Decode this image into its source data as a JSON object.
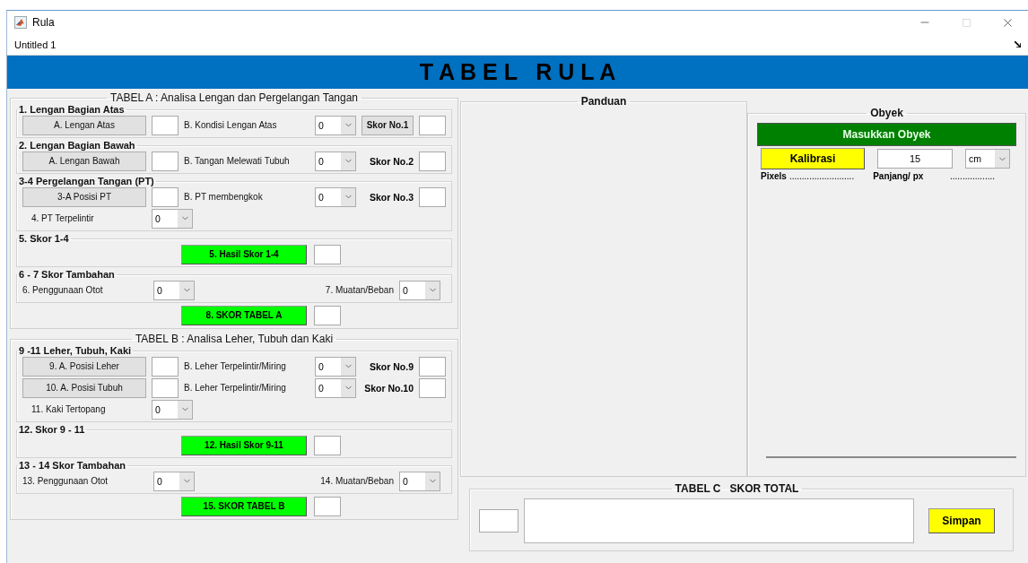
{
  "window": {
    "title": "Rula",
    "menu": "Untitled 1"
  },
  "banner": {
    "title": "T A B E L   R U L A"
  },
  "table_a": {
    "title": "TABEL A : Analisa Lengan dan Pergelangan Tangan",
    "groups": [
      {
        "kind": "grid",
        "title": "1. Lengan Bagian Atas",
        "rows": [
          [
            {
              "kind": "button",
              "label": "A. Lengan Atas"
            },
            {
              "kind": "field"
            },
            {
              "kind": "label",
              "text": "B. Kondisi Lengan Atas"
            },
            {
              "kind": "select",
              "value": "0"
            },
            {
              "kind": "score_button",
              "label": "Skor No.1"
            },
            {
              "kind": "field"
            }
          ]
        ]
      },
      {
        "kind": "grid",
        "title": "2. Lengan Bagian Bawah",
        "rows": [
          [
            {
              "kind": "button",
              "label": "A. Lengan Bawah"
            },
            {
              "kind": "field"
            },
            {
              "kind": "label",
              "text": "B. Tangan Melewati Tubuh"
            },
            {
              "kind": "select",
              "value": "0"
            },
            {
              "kind": "score_label",
              "text": "Skor No.2"
            },
            {
              "kind": "field"
            }
          ]
        ]
      },
      {
        "kind": "grid",
        "title": "3-4 Pergelangan Tangan (PT)",
        "rows": [
          [
            {
              "kind": "button",
              "label": "3-A Posisi PT"
            },
            {
              "kind": "field"
            },
            {
              "kind": "label",
              "text": "B. PT membengkok"
            },
            {
              "kind": "select",
              "value": "0"
            },
            {
              "kind": "score_label",
              "text": "Skor No.3"
            },
            {
              "kind": "field"
            }
          ],
          [
            {
              "kind": "label",
              "text": "4. PT Terpelintir"
            },
            {
              "kind": "select",
              "value": "0"
            }
          ]
        ]
      },
      {
        "kind": "center",
        "title": "5. Skor 1-4",
        "rows": [
          [
            {
              "kind": "green_button",
              "label": "5. Hasil Skor 1-4"
            },
            {
              "kind": "field"
            }
          ]
        ]
      },
      {
        "kind": "pairs",
        "title": "6 - 7 Skor Tambahan",
        "rows": [
          [
            {
              "kind": "label",
              "text": "6. Penggunaan Otot"
            },
            {
              "kind": "select",
              "value": "0"
            },
            {
              "kind": "label",
              "text": "7. Muatan/Beban"
            },
            {
              "kind": "select",
              "value": "0"
            }
          ]
        ]
      }
    ],
    "total": [
      {
        "kind": "green_button",
        "label": "8. SKOR TABEL A"
      },
      {
        "kind": "field"
      }
    ]
  },
  "table_b": {
    "title": "TABEL B : Analisa Leher, Tubuh dan Kaki",
    "groups": [
      {
        "kind": "grid",
        "title": "9 -11 Leher, Tubuh, Kaki",
        "rows": [
          [
            {
              "kind": "button",
              "label": "9. A. Posisi Leher"
            },
            {
              "kind": "field"
            },
            {
              "kind": "label",
              "text": "B. Leher Terpelintir/Miring"
            },
            {
              "kind": "select",
              "value": "0"
            },
            {
              "kind": "score_label",
              "text": "Skor No.9"
            },
            {
              "kind": "field"
            }
          ],
          [
            {
              "kind": "button",
              "label": "10. A. Posisi Tubuh"
            },
            {
              "kind": "field"
            },
            {
              "kind": "label",
              "text": "B. Leher Terpelintir/Miring"
            },
            {
              "kind": "select",
              "value": "0"
            },
            {
              "kind": "score_label",
              "text": "Skor No.10"
            },
            {
              "kind": "field"
            }
          ],
          [
            {
              "kind": "label",
              "text": "11. Kaki Tertopang"
            },
            {
              "kind": "select",
              "value": "0"
            }
          ]
        ]
      },
      {
        "kind": "center",
        "title": "12. Skor 9 - 11",
        "rows": [
          [
            {
              "kind": "green_button",
              "label": "12. Hasil Skor 9-11"
            },
            {
              "kind": "field"
            }
          ]
        ]
      },
      {
        "kind": "pairs",
        "title": "13 - 14 Skor Tambahan",
        "rows": [
          [
            {
              "kind": "label",
              "text": "13. Penggunaan Otot"
            },
            {
              "kind": "select",
              "value": "0"
            },
            {
              "kind": "label",
              "text": "14. Muatan/Beban"
            },
            {
              "kind": "select",
              "value": "0"
            }
          ]
        ]
      }
    ],
    "total": [
      {
        "kind": "green_button",
        "label": "15. SKOR TABEL B"
      },
      {
        "kind": "field"
      }
    ]
  },
  "guide": {
    "title": "Panduan"
  },
  "object": {
    "title": "Obyek",
    "load_button": "Masukkan Obyek",
    "calibrate_button": "Kalibrasi",
    "length_value": "15",
    "unit": "cm",
    "pixels_label": "Pixels",
    "pixels_value": "..........................",
    "length_label": "Panjang/ px",
    "length_per_px": ".................."
  },
  "table_c": {
    "title": "TABEL C   SKOR TOTAL",
    "save_button": "Simpan"
  }
}
